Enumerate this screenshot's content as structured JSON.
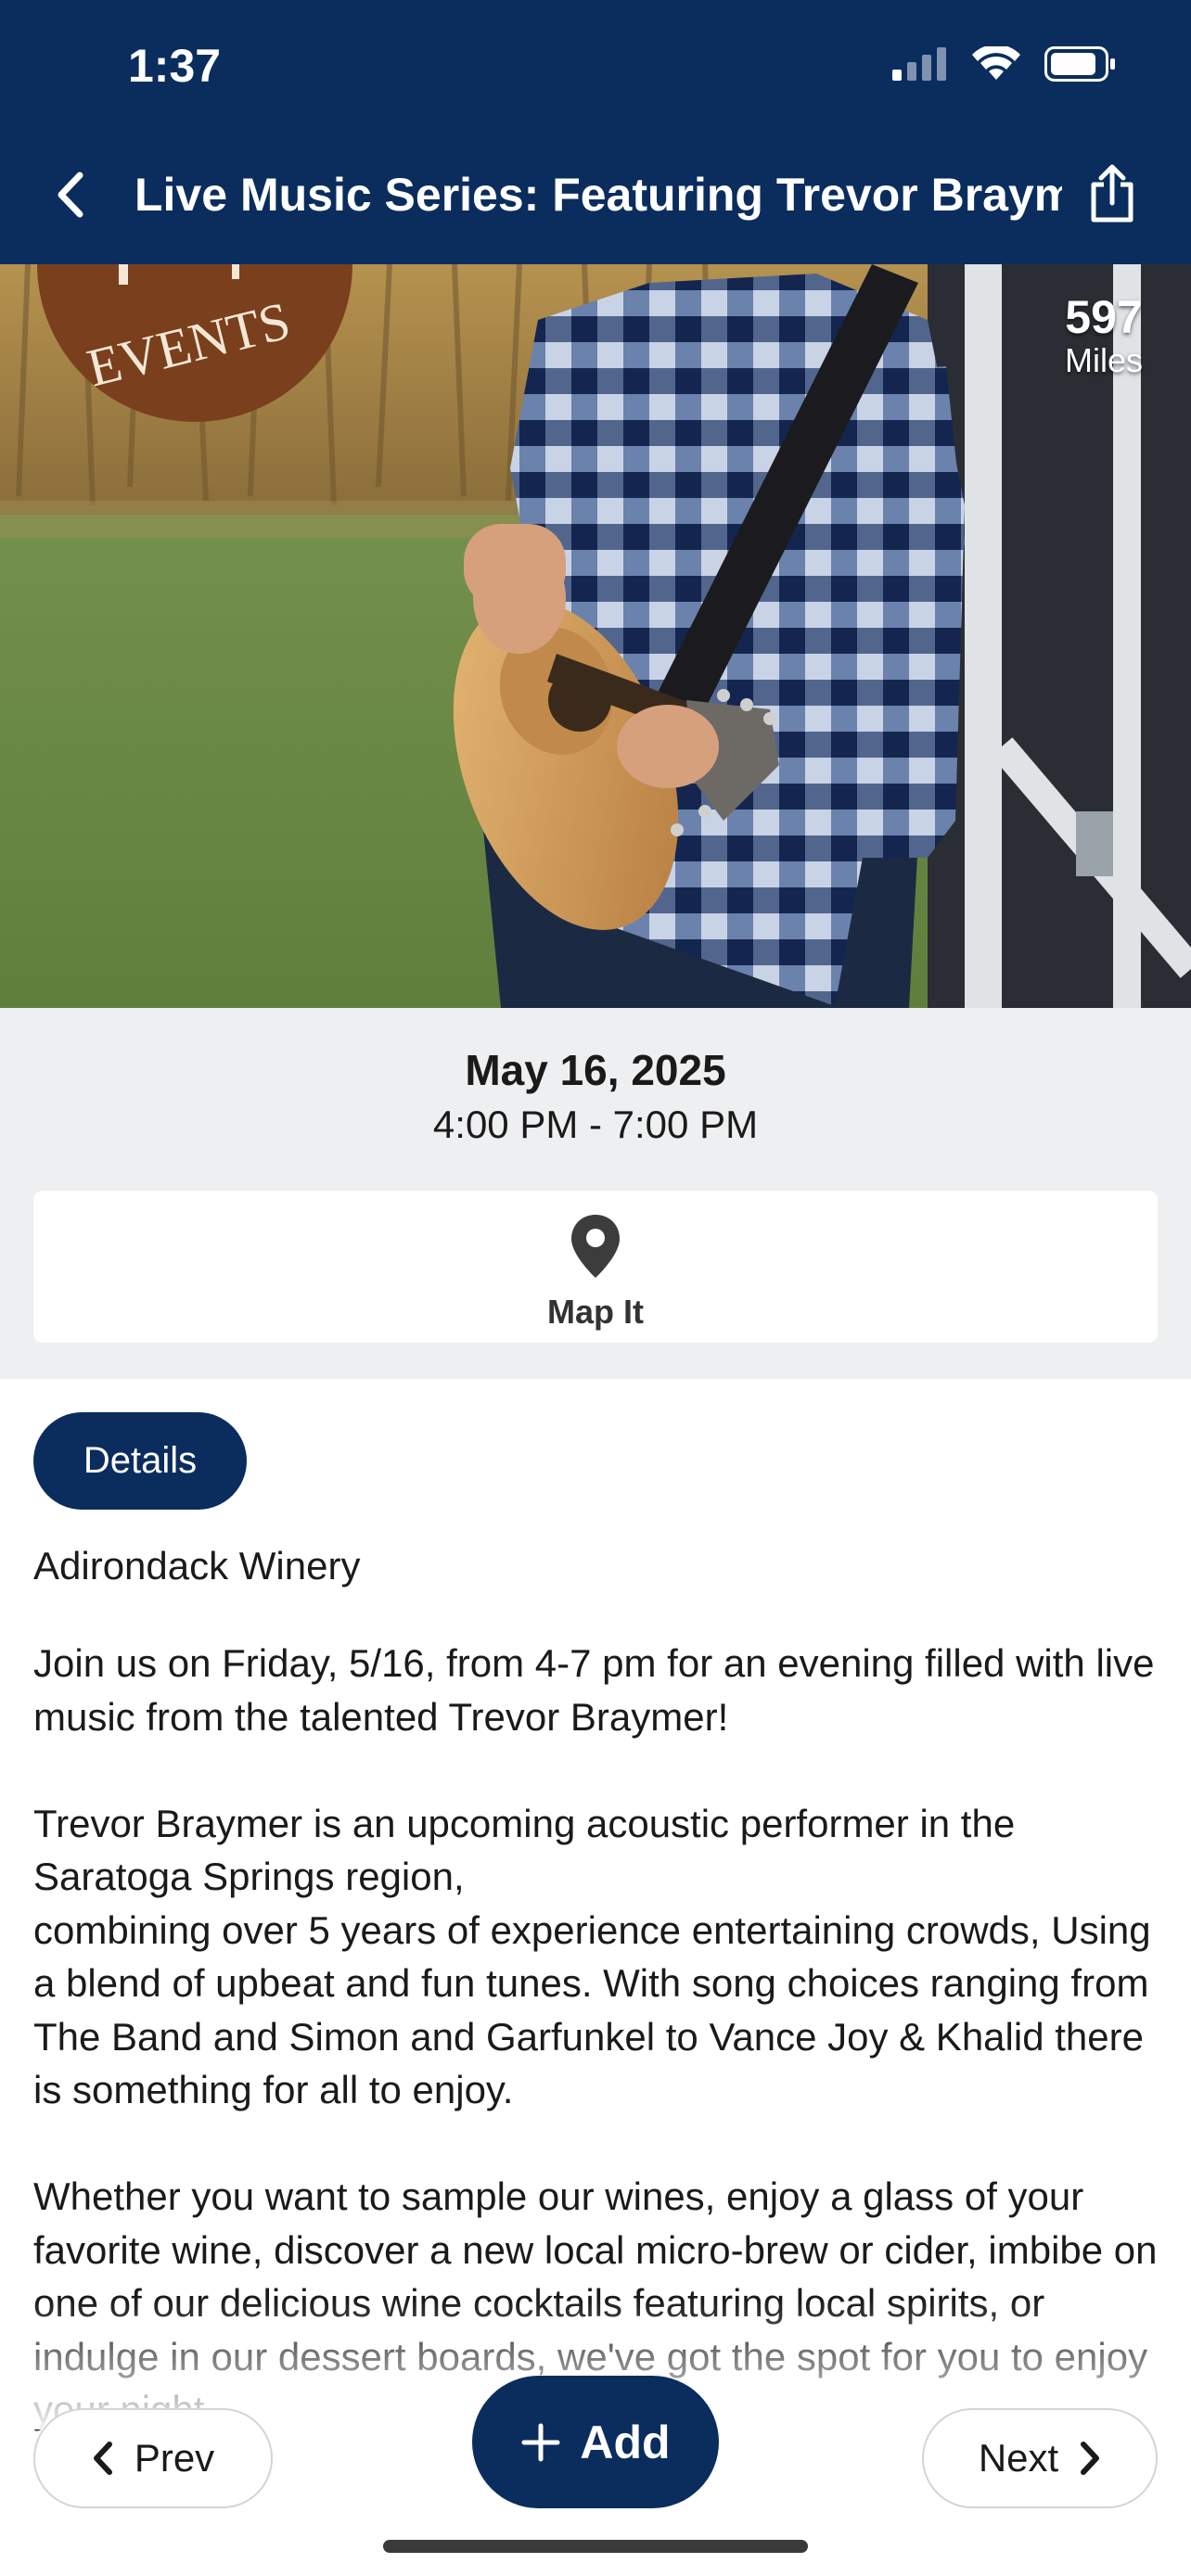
{
  "status_bar": {
    "time": "1:37"
  },
  "nav": {
    "title": "Live Music Series: Featuring Trevor Braymer"
  },
  "hero": {
    "logo_text": "EVENTS",
    "distance_value": "597",
    "distance_unit": "Miles"
  },
  "event": {
    "date": "May 16, 2025",
    "time": "4:00 PM - 7:00 PM",
    "map_label": "Map It",
    "tab_label": "Details",
    "venue": "Adirondack Winery",
    "description": "Join us on Friday, 5/16, from 4-7 pm for an evening filled with live music from the talented Trevor Braymer!\n\nTrevor Braymer is an upcoming acoustic performer in the Saratoga Springs region,\ncombining over 5 years of experience entertaining crowds, Using a blend of upbeat and fun tunes. With song choices ranging from The Band and Simon and Garfunkel to Vance Joy & Khalid there is something for all to enjoy.\n\nWhether you want to sample our wines, enjoy a glass of your favorite wine, discover a new local micro-brew or cider, imbibe on one of our delicious wine cocktails featuring local spirits, or indulge in our dessert boards, we've got the spot for you to enjoy your night"
  },
  "footer": {
    "prev_label": "Prev",
    "add_label": "Add",
    "next_label": "Next"
  },
  "colors": {
    "brand_navy": "#0a2d5e",
    "panel_gray": "#eeeff0",
    "logo_brown": "#7a3f1c"
  }
}
